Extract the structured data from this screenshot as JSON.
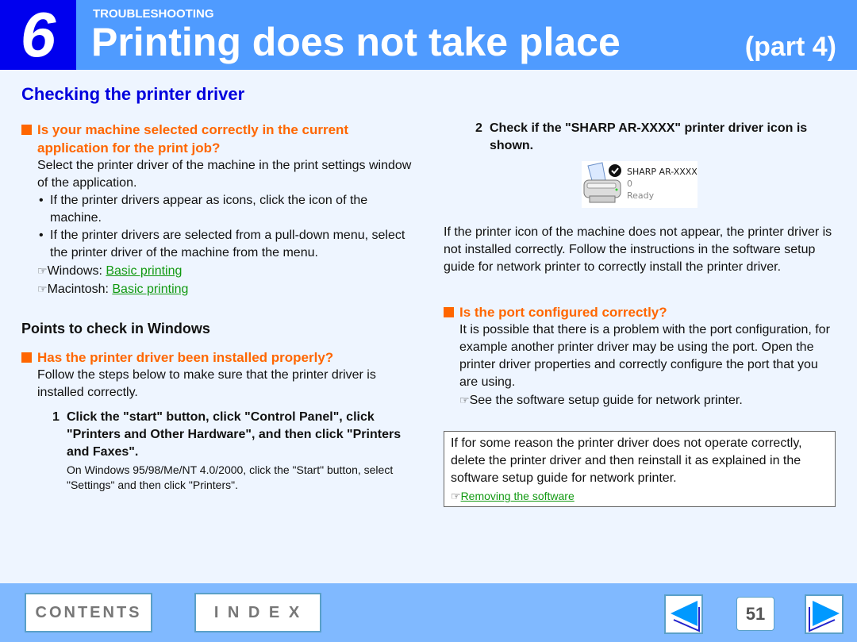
{
  "header": {
    "chapter_number": "6",
    "section": "TROUBLESHOOTING",
    "title": "Printing does not take place",
    "part": "(part 4)"
  },
  "heading": "Checking the printer driver",
  "left": {
    "q1": {
      "title_line1": "Is your machine selected correctly in the current",
      "title_line2": "application for the print job?",
      "body": "Select the printer driver of the machine in the print settings window of the application.",
      "bullets": [
        "If the printer drivers appear as icons, click the icon of the machine.",
        "If the printer drivers are selected from a pull-down menu, select the printer driver of the machine from the menu."
      ],
      "refs": [
        {
          "prefix": "Windows: ",
          "link": "Basic printing"
        },
        {
          "prefix": "Macintosh: ",
          "link": "Basic printing"
        }
      ]
    },
    "points_heading": "Points to check in Windows",
    "q2": {
      "title": "Has the printer driver been installed properly?",
      "body": "Follow the steps below to make sure that the printer driver is installed correctly."
    },
    "step1": {
      "num": "1",
      "text": "Click the \"start\" button, click \"Control Panel\", click \"Printers and Other Hardware\", and then click \"Printers and Faxes\".",
      "note": "On Windows 95/98/Me/NT 4.0/2000, click the \"Start\" button, select \"Settings\" and then click \"Printers\"."
    }
  },
  "right": {
    "step2": {
      "num": "2",
      "text": "Check if the \"SHARP AR-XXXX\" printer driver icon is shown."
    },
    "printer_icon": {
      "name": "SHARP AR-XXXX",
      "jobs": "0",
      "status": "Ready"
    },
    "not_appear": "If the printer icon of the machine does not appear, the printer driver is not installed correctly. Follow the instructions in the software setup guide for network printer to correctly install the printer driver.",
    "q3": {
      "title": "Is the port configured correctly?",
      "body": "It is possible that there is a problem with the port configuration, for example another printer driver may be using the port. Open the printer driver properties and correctly configure the port that you are using.",
      "ref": "See the software setup guide for network printer."
    },
    "note": {
      "body": "If for some reason the printer driver does not operate correctly, delete the printer driver and then reinstall it as explained in the software setup guide for network printer.",
      "link": "Removing the software"
    }
  },
  "footer": {
    "contents": "CONTENTS",
    "index": "I N D E X",
    "page": "51"
  },
  "icons": {
    "hand": "☞"
  }
}
